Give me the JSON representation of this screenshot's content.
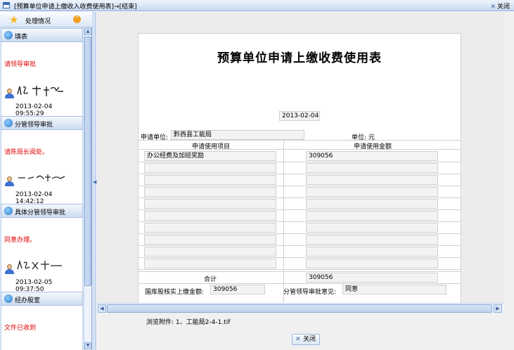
{
  "window": {
    "title": "[预算单位申请上缴收入收费使用表]→[结束]",
    "close_label": "关闭"
  },
  "sidebar": {
    "header_label": "处理情况",
    "steps": [
      {
        "title": "填表",
        "opinion": "请领导审批",
        "time": "2013-02-04 09:55:29"
      },
      {
        "title": "分管领导审批",
        "opinion": "请陈局长阅处。",
        "time": "2013-02-04 14:42:12"
      },
      {
        "title": "具体分管领导审批",
        "opinion": "同意办理。",
        "time": "2013-02-05 09:37:50"
      },
      {
        "title": "经办股室",
        "opinion": "文件已收到"
      }
    ]
  },
  "form": {
    "title": "预算单位申请上缴收费使用表",
    "date": "2013-02-04",
    "unit_label": "申请单位:",
    "unit_value": "黔西县工能局",
    "currency_label": "单位: 元",
    "col_item": "申请使用项目",
    "col_amount": "申请使用金额",
    "rows": [
      {
        "item": "办公经费及加班奖励",
        "amount": "309056"
      },
      {
        "item": "",
        "amount": ""
      },
      {
        "item": "",
        "amount": ""
      },
      {
        "item": "",
        "amount": ""
      },
      {
        "item": "",
        "amount": ""
      },
      {
        "item": "",
        "amount": ""
      },
      {
        "item": "",
        "amount": ""
      },
      {
        "item": "",
        "amount": ""
      },
      {
        "item": "",
        "amount": ""
      },
      {
        "item": "",
        "amount": ""
      }
    ],
    "total_label": "合计",
    "total_value": "309056",
    "treasury_label": "国库股核实上缴金额:",
    "treasury_value": "309056",
    "leader_label": "分管领导审批意见:",
    "leader_value": "同意"
  },
  "attachments": {
    "label": "浏览附件:",
    "file": "1、工能局2-4-1.tif"
  },
  "footer": {
    "close_label": "关闭"
  }
}
